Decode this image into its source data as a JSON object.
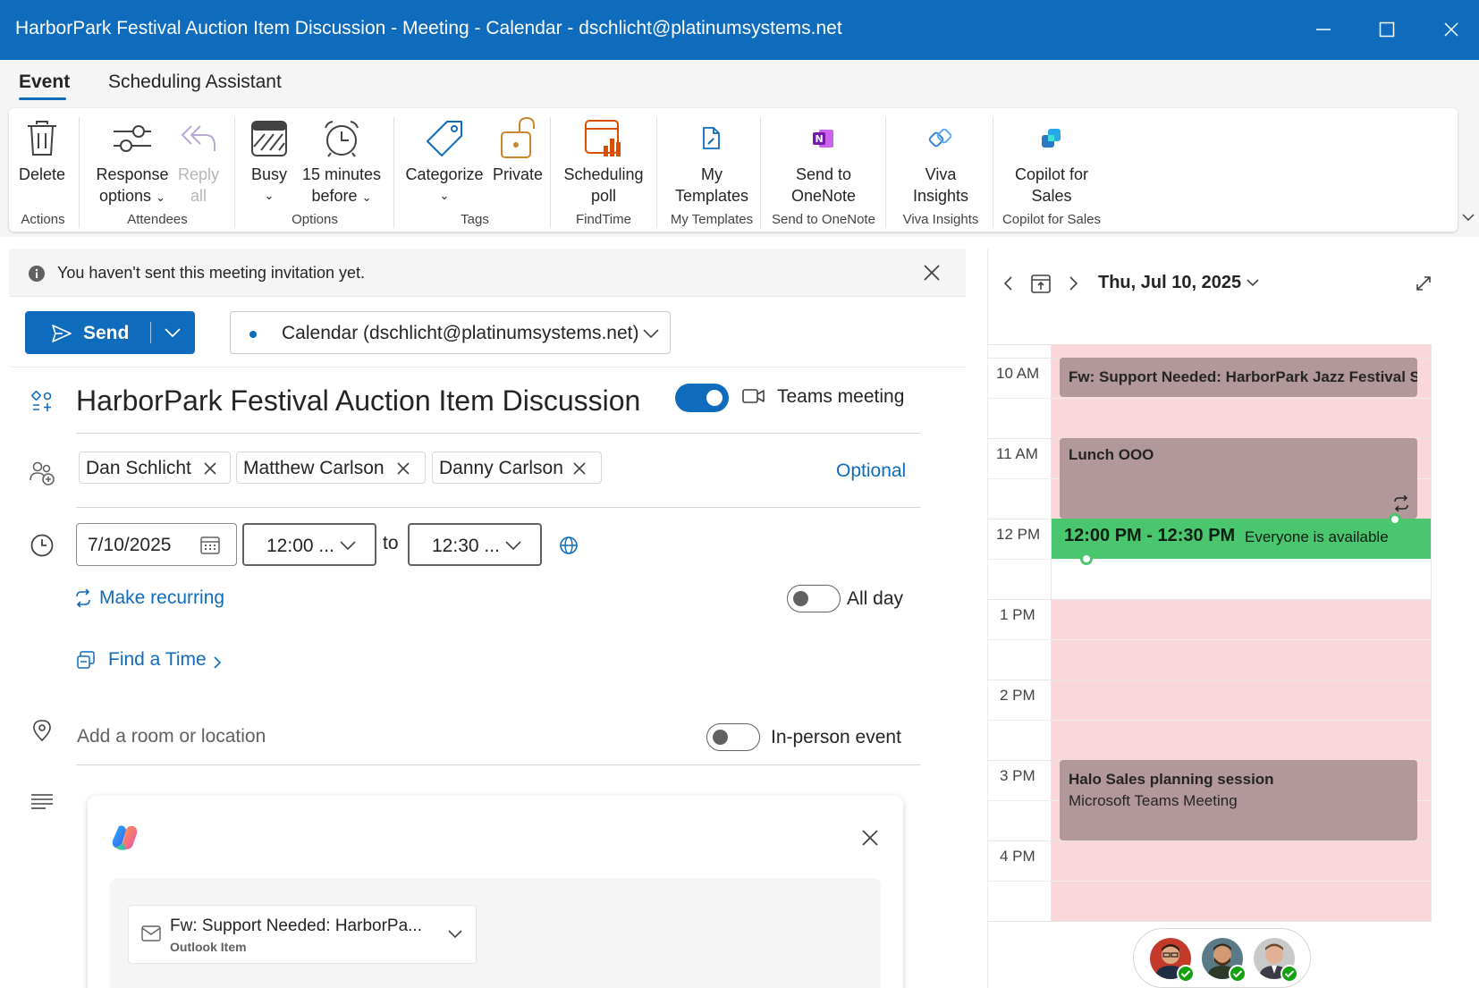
{
  "window": {
    "title": "HarborPark Festival Auction Item Discussion - Meeting - Calendar - dschlicht@platinumsystems.net"
  },
  "tabs": [
    {
      "label": "Event",
      "active": true
    },
    {
      "label": "Scheduling Assistant",
      "active": false
    }
  ],
  "ribbon": {
    "groups": [
      {
        "label": "Actions",
        "items": [
          {
            "label": "Delete",
            "icon": "trash-icon"
          }
        ]
      },
      {
        "label": "Attendees",
        "items": [
          {
            "label_line1": "Response",
            "label_line2": "options",
            "icon": "response-options-icon",
            "dropdown": true
          },
          {
            "label_line1": "Reply",
            "label_line2": "all",
            "icon": "reply-all-icon",
            "disabled": true
          }
        ]
      },
      {
        "label": "Options",
        "items": [
          {
            "label": "Busy",
            "icon": "busy-icon",
            "dropdown": true
          },
          {
            "label_line1": "15 minutes",
            "label_line2": "before",
            "icon": "alarm-clock-icon",
            "dropdown": true
          }
        ]
      },
      {
        "label": "Tags",
        "items": [
          {
            "label": "Categorize",
            "icon": "tag-icon",
            "dropdown": true
          },
          {
            "label": "Private",
            "icon": "lock-icon"
          }
        ]
      },
      {
        "label": "FindTime",
        "items": [
          {
            "label_line1": "Scheduling",
            "label_line2": "poll",
            "icon": "poll-icon"
          }
        ]
      },
      {
        "label": "My Templates",
        "items": [
          {
            "label_line1": "My",
            "label_line2": "Templates",
            "icon": "template-icon"
          }
        ]
      },
      {
        "label": "Send to OneNote",
        "items": [
          {
            "label_line1": "Send to",
            "label_line2": "OneNote",
            "icon": "onenote-icon"
          }
        ]
      },
      {
        "label": "Viva Insights",
        "items": [
          {
            "label_line1": "Viva",
            "label_line2": "Insights",
            "icon": "viva-insights-icon"
          }
        ]
      },
      {
        "label": "Copilot for Sales",
        "items": [
          {
            "label_line1": "Copilot for",
            "label_line2": "Sales",
            "icon": "copilot-sales-icon"
          }
        ]
      }
    ]
  },
  "infobar": {
    "text": "You haven't sent this meeting invitation yet."
  },
  "send_button": {
    "label": "Send"
  },
  "calendar_select": {
    "label": "Calendar (dschlicht@platinumsystems.net)"
  },
  "subject": "HarborPark Festival Auction Item Discussion",
  "teams": {
    "label": "Teams meeting",
    "enabled": true
  },
  "attendees": [
    {
      "name": "Dan Schlicht"
    },
    {
      "name": "Matthew Carlson"
    },
    {
      "name": "Danny Carlson"
    }
  ],
  "optional_label": "Optional",
  "date": {
    "value": "7/10/2025"
  },
  "start_time": {
    "value": "12:00 ..."
  },
  "to_label": "to",
  "end_time": {
    "value": "12:30 ..."
  },
  "make_recurring": "Make recurring",
  "all_day": {
    "label": "All day",
    "enabled": false
  },
  "find_time": "Find a Time",
  "location": {
    "placeholder": "Add a room or location"
  },
  "in_person": {
    "label": "In-person event",
    "enabled": false
  },
  "copilot": {
    "attachment_title": "Fw: Support Needed: HarborPa...",
    "attachment_type": "Outlook Item"
  },
  "day_view": {
    "date_label": "Thu, Jul 10, 2025",
    "hours": [
      "10 AM",
      "11 AM",
      "12 PM",
      "1 PM",
      "2 PM",
      "3 PM",
      "4 PM"
    ],
    "events": [
      {
        "title": "Fw: Support Needed: HarborPark Jazz Festival S"
      },
      {
        "title": "Lunch OOO"
      },
      {
        "title": "Halo Sales planning session",
        "subtitle": "Microsoft Teams Meeting"
      }
    ],
    "proposed": {
      "time": "12:00 PM - 12:30 PM",
      "status": "Everyone is available"
    }
  },
  "colors": {
    "brand": "#0f6cbd",
    "busy_background": "#f9d7da",
    "event": "#b3989b",
    "available": "#4ac66f"
  }
}
